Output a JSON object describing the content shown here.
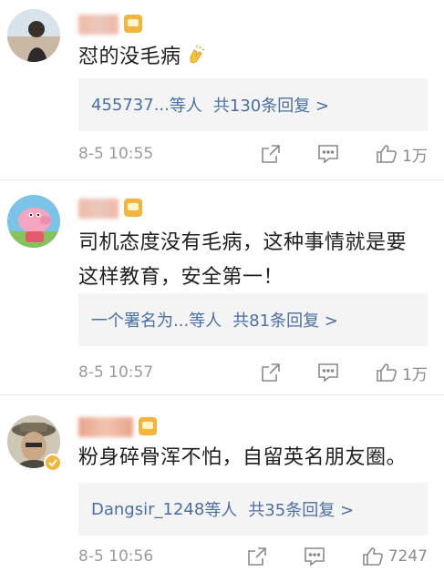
{
  "comments": [
    {
      "text": "怼的没毛病",
      "reply_user": "455737...",
      "reply_suffix": "等人",
      "reply_count": "共130条回复 >",
      "time": "8-5 10:55",
      "likes": "1万"
    },
    {
      "text_line1": "司机态度没有毛病，这种事情就是要",
      "text_line2": "这样教育，安全第一！",
      "reply_user": "一个署名为...",
      "reply_suffix": "等人",
      "reply_count": "共81条回复 >",
      "time": "8-5 10:57",
      "likes": "1万"
    },
    {
      "text": "粉身碎骨浑不怕，自留英名朋友圈。",
      "reply_user": "Dangsir_1248",
      "reply_suffix": "等人",
      "reply_count": "共35条回复 >",
      "time": "8-5 10:56",
      "likes": "7247"
    }
  ],
  "colors": {
    "link": "#4a6fa5",
    "reply_bg": "#f4f4f4",
    "meta": "#9b9b9b",
    "badge": "#f4b53f"
  },
  "icons": [
    "share-icon",
    "comment-icon",
    "thumbs-up-icon",
    "clap-emoji",
    "verified-badge-icon"
  ]
}
